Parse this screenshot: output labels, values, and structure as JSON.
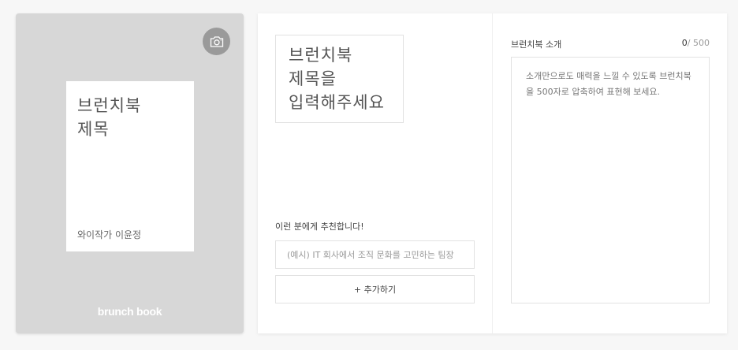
{
  "cover": {
    "title_line1": "브런치북",
    "title_line2": "제목",
    "author": "와이작가 이윤정",
    "brand": "brunch book",
    "camera_icon": "camera-icon"
  },
  "editor": {
    "title_placeholder_line1": "브런치북",
    "title_placeholder_line2": "제목을",
    "title_placeholder_line3": "입력해주세요",
    "recommend_label": "이런 분에게 추천합니다!",
    "recommend_placeholder": "(예시) IT 회사에서 조직 문화를 고민하는 팀장",
    "add_button_label": "+ 추가하기",
    "intro_label": "브런치북 소개",
    "counter_current": "0",
    "counter_max": "/ 500",
    "intro_placeholder": "소개만으로도 매력을 느낄 수 있도록 브런치북을 500자로 압축하여 표현해 보세요."
  },
  "colors": {
    "cover_bg": "#d7d7d7",
    "camera_bg": "#9a9a9a",
    "border": "#e2e2e2"
  }
}
